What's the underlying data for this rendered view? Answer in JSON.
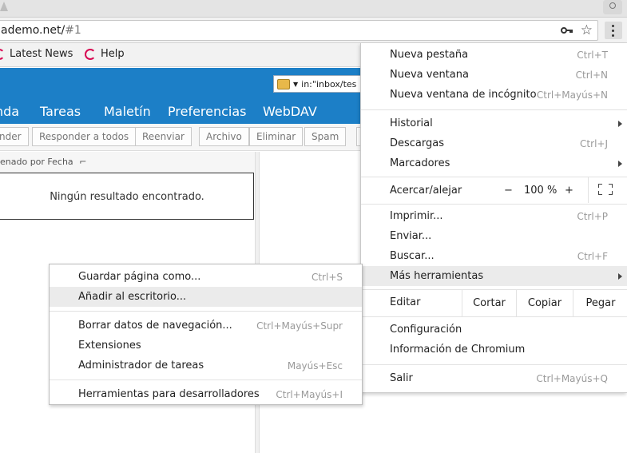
{
  "browser": {
    "url_host": "ademo.net/",
    "url_fragment": "#1",
    "bookmarks": [
      {
        "label": "Latest News"
      },
      {
        "label": "Help"
      }
    ]
  },
  "webmail": {
    "search_text": "in:\"inbox/tes",
    "nav": [
      "nda",
      "Tareas",
      "Maletín",
      "Preferencias",
      "WebDAV"
    ],
    "toolbar": [
      "nder",
      "Responder a todos",
      "Reenviar",
      "Archivo",
      "Eliminar",
      "Spam"
    ],
    "sort_label": "enado por Fecha",
    "empty_message": "Ningún resultado encontrado."
  },
  "menu": {
    "new_tab": {
      "label": "Nueva pestaña",
      "shortcut": "Ctrl+T"
    },
    "new_window": {
      "label": "Nueva ventana",
      "shortcut": "Ctrl+N"
    },
    "incognito": {
      "label": "Nueva ventana de incógnito",
      "shortcut": "Ctrl+Mayús+N"
    },
    "history": {
      "label": "Historial"
    },
    "downloads": {
      "label": "Descargas",
      "shortcut": "Ctrl+J"
    },
    "bookmarks": {
      "label": "Marcadores"
    },
    "zoom": {
      "label": "Acercar/alejar",
      "minus": "−",
      "level": "100 %",
      "plus": "+"
    },
    "print": {
      "label": "Imprimir...",
      "shortcut": "Ctrl+P"
    },
    "cast": {
      "label": "Enviar..."
    },
    "find": {
      "label": "Buscar...",
      "shortcut": "Ctrl+F"
    },
    "more_tools": {
      "label": "Más herramientas"
    },
    "edit": {
      "label": "Editar",
      "cut": "Cortar",
      "copy": "Copiar",
      "paste": "Pegar"
    },
    "settings": {
      "label": "Configuración"
    },
    "about": {
      "label": "Información de Chromium"
    },
    "exit": {
      "label": "Salir",
      "shortcut": "Ctrl+Mayús+Q"
    }
  },
  "submenu": {
    "save_page": {
      "label": "Guardar página como...",
      "shortcut": "Ctrl+S"
    },
    "add_desktop": {
      "label": "Añadir al escritorio..."
    },
    "clear_data": {
      "label": "Borrar datos de navegación...",
      "shortcut": "Ctrl+Mayús+Supr"
    },
    "extensions": {
      "label": "Extensiones"
    },
    "task_manager": {
      "label": "Administrador de tareas",
      "shortcut": "Mayús+Esc"
    },
    "dev_tools": {
      "label": "Herramientas para desarrolladores",
      "shortcut": "Ctrl+Mayús+I"
    }
  },
  "colors": {
    "app_blue": "#1c7fc7",
    "highlight": "#ebebeb",
    "debian_red": "#d70751"
  }
}
